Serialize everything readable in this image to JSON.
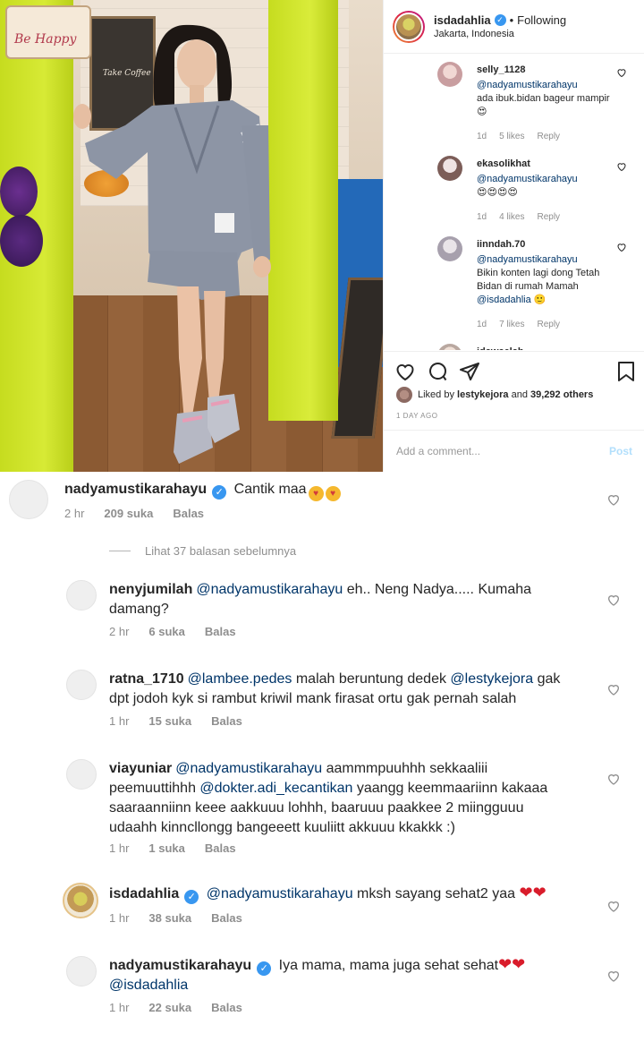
{
  "post": {
    "photo_sign_text": "Be Happy",
    "photo_menu_text": "Take Coffee",
    "header": {
      "username": "isdadahlia",
      "separator": "•",
      "follow_status": "Following",
      "location": "Jakarta, Indonesia"
    },
    "side_comments": [
      {
        "username": "selly_1128",
        "text_mention": "@nadyamustikarahayu",
        "text": "ada ibuk.bidan bageur mampir😍",
        "time": "1d",
        "likes": "5 likes",
        "reply": "Reply"
      },
      {
        "username": "ekasolikhat",
        "text_mention": "@nadyamustikarahayu",
        "text": "😍😍😍😍",
        "time": "1d",
        "likes": "4 likes",
        "reply": "Reply"
      },
      {
        "username": "iinndah.70",
        "text_mention": "@nadyamustikarahayu",
        "text": "Bikin konten lagi dong Tetah Bidan di rumah Mamah",
        "text_mention2": "@isdadahlia",
        "text_emoji": "🙂",
        "time": "1d",
        "likes": "7 likes",
        "reply": "Reply"
      },
      {
        "username": "idawaelah"
      }
    ],
    "liked_by_prefix": "Liked by",
    "liked_by_user": "lestykejora",
    "liked_by_and": "and",
    "liked_by_count": "39,292 others",
    "post_time": "1 DAY AGO",
    "add_comment_placeholder": "Add a comment...",
    "post_button": "Post"
  },
  "thread": {
    "main": {
      "username": "nadyamustikarahayu",
      "text": "Cantik maa",
      "time": "2 hr",
      "likes": "209 suka",
      "reply": "Balas"
    },
    "view_replies": "Lihat 37 balasan sebelumnya",
    "replies": [
      {
        "username": "nenyjumilah",
        "mention": "@nadyamustikarahayu",
        "text": " eh.. Neng Nadya..... Kumaha",
        "text2": "damang?",
        "time": "2 hr",
        "likes": "6 suka",
        "reply": "Balas"
      },
      {
        "username": "ratna_1710",
        "mention": "@lambee.pedes",
        "text": " malah beruntung dedek ",
        "mention2": "@lestykejora",
        "text_end": " gak",
        "text2": "dpt jodoh kyk si rambut kriwil mank firasat ortu gak pernah salah",
        "time": "1 hr",
        "likes": "15 suka",
        "reply": "Balas"
      },
      {
        "username": "viayuniar",
        "mention": "@nadyamustikarahayu",
        "text": " aammmpuuhhh sekkaaliii",
        "line2": "peemuuttihhh ",
        "mention2": "@dokter.adi_kecantikan",
        "line2_end": " yaangg keemmaariinn kakaaa",
        "line3": "saaraanniinn keee aakkuuu lohhh, baaruuu paakkee 2 miingguuu",
        "line4": "udaahh kinncllongg bangeeett kuuliitt akkuuu kkakkk :)",
        "time": "1 hr",
        "likes": "1 suka",
        "reply": "Balas"
      },
      {
        "username": "isdadahlia",
        "mention": "@nadyamustikarahayu",
        "text": " mksh sayang sehat2 yaa ",
        "hearts": "❤❤",
        "time": "1 hr",
        "likes": "38 suka",
        "reply": "Balas"
      },
      {
        "username": "nadyamustikarahayu",
        "text": " Iya mama, mama juga sehat sehat",
        "hearts": "❤❤",
        "mention_line2": "@isdadahlia",
        "time": "1 hr",
        "likes": "22 suka",
        "reply": "Balas"
      }
    ]
  },
  "colors": {
    "mention": "#003569",
    "verified": "#3897f0",
    "meta_gray": "#8e8e8e",
    "pillar_lime": "#c6dc1f"
  }
}
